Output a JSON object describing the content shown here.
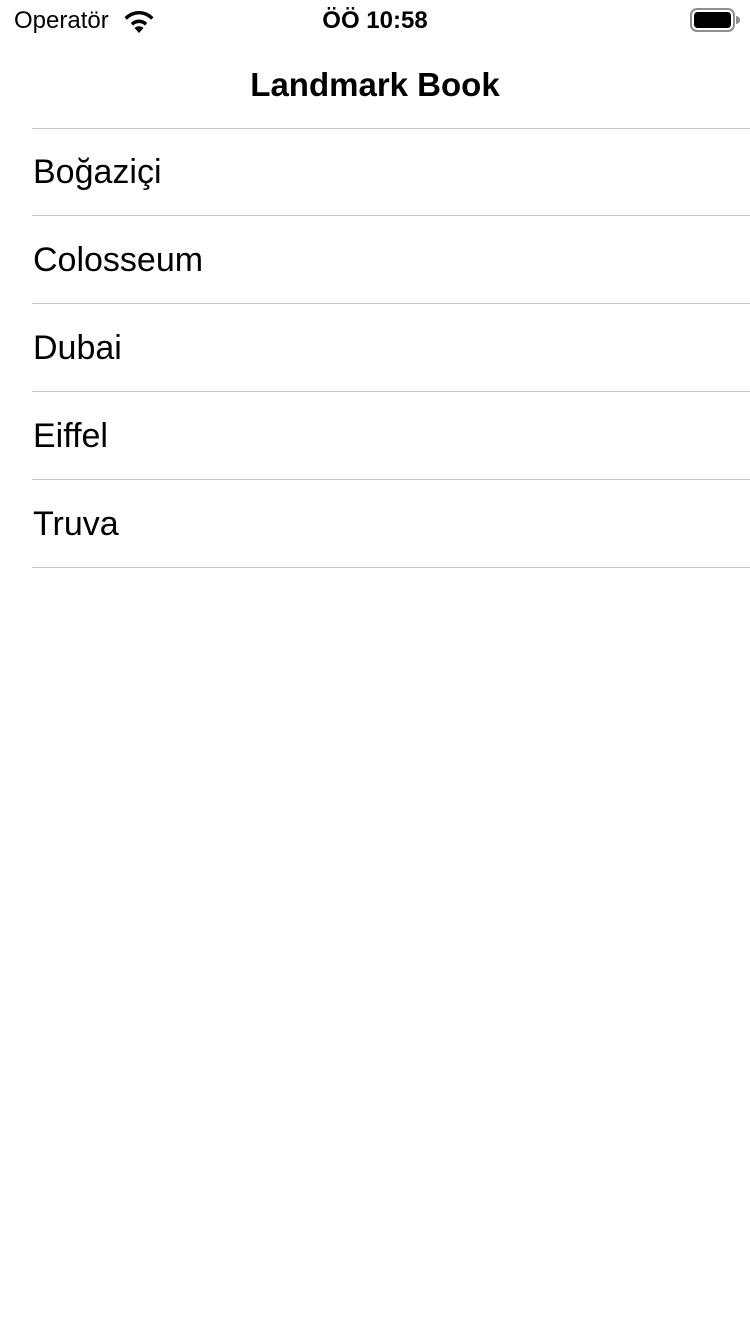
{
  "status_bar": {
    "carrier": "Operatör",
    "time": "ÖÖ 10:58",
    "wifi_icon": "wifi-icon",
    "battery_icon": "battery-icon"
  },
  "nav_bar": {
    "title": "Landmark Book"
  },
  "landmarks": [
    {
      "name": "Boğaziçi"
    },
    {
      "name": "Colosseum"
    },
    {
      "name": "Dubai"
    },
    {
      "name": "Eiffel"
    },
    {
      "name": "Truva"
    }
  ],
  "colors": {
    "background": "#ffffff",
    "text": "#000000",
    "separator": "#c8c7cc"
  }
}
